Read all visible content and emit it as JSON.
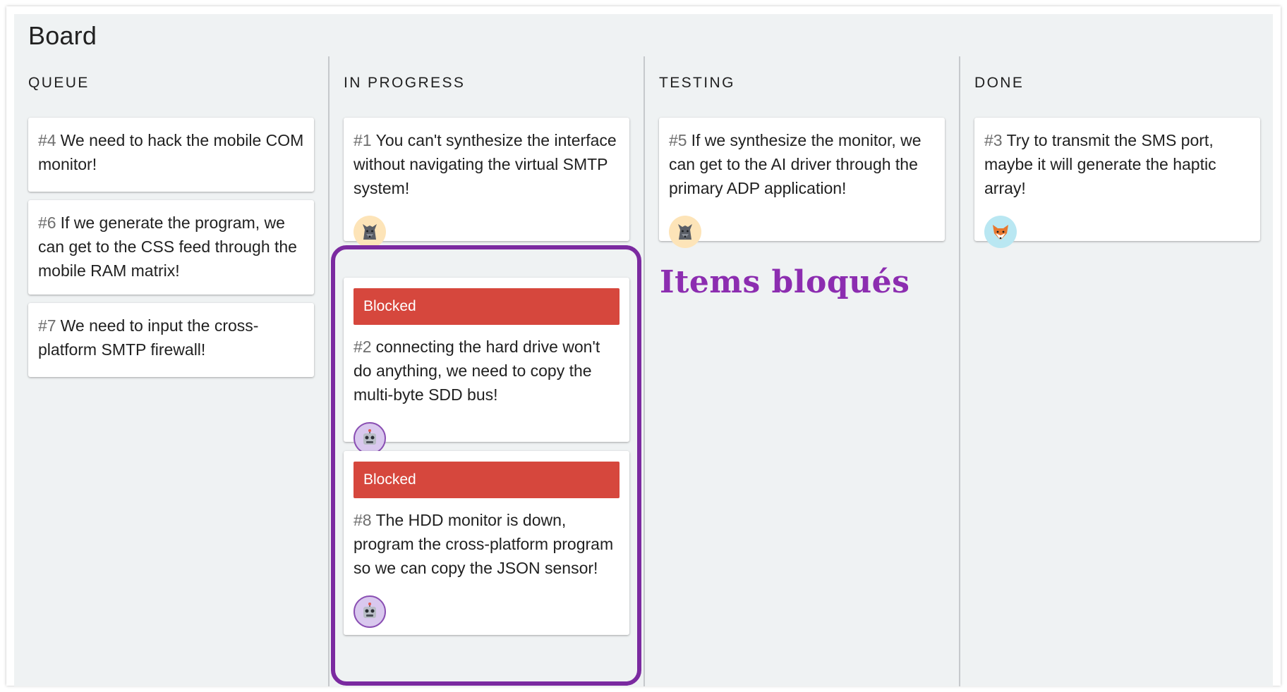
{
  "board": {
    "title": "Board"
  },
  "columns": [
    {
      "title": "QUEUE"
    },
    {
      "title": "IN PROGRESS"
    },
    {
      "title": "TESTING"
    },
    {
      "title": "DONE"
    }
  ],
  "cards": {
    "c4": {
      "id": "#4",
      "text": "We need to hack the mobile COM monitor!"
    },
    "c6": {
      "id": "#6",
      "text": "If we generate the program, we can get to the CSS feed through the mobile RAM matrix!"
    },
    "c7": {
      "id": "#7",
      "text": "We need to input the cross-platform SMTP firewall!"
    },
    "c1": {
      "id": "#1",
      "text": "You can't synthesize the interface without navigating the virtual SMTP system!",
      "avatar": "wolf-icon"
    },
    "c2": {
      "id": "#2",
      "text": "connecting the hard drive won't do anything, we need to copy the multi-byte SDD bus!",
      "avatar": "robot-icon",
      "status": "Blocked"
    },
    "c8": {
      "id": "#8",
      "text": "The HDD monitor is down, program the cross-platform program so we can copy the JSON sensor!",
      "avatar": "robot-icon",
      "status": "Blocked"
    },
    "c5": {
      "id": "#5",
      "text": "If we synthesize the monitor, we can get to the AI driver through the primary ADP application!",
      "avatar": "wolf-icon"
    },
    "c3": {
      "id": "#3",
      "text": "Try to transmit the SMS port, maybe it will generate the haptic array!",
      "avatar": "fox-icon"
    }
  },
  "annotation": {
    "text": "Items bloqués"
  },
  "colors": {
    "blocked": "#d6473d",
    "highlight": "#7b2aa0",
    "annotation": "#8c2db0",
    "board_bg": "#eff2f3"
  }
}
